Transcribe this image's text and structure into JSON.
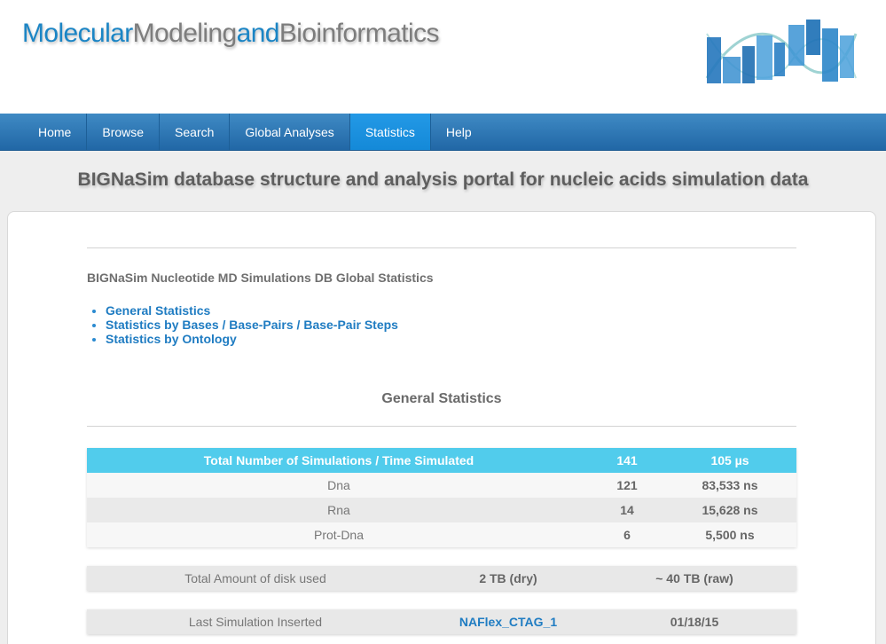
{
  "header": {
    "brand_part1": "Molecular",
    "brand_part2": "Modeling",
    "brand_part3": "and",
    "brand_part4": "Bioinformatics",
    "logo_icon": "bignasim-word-cloud-logo"
  },
  "nav": {
    "items": [
      {
        "label": "Home"
      },
      {
        "label": "Browse"
      },
      {
        "label": "Search"
      },
      {
        "label": "Global Analyses"
      },
      {
        "label": "Statistics"
      },
      {
        "label": "Help"
      }
    ],
    "active": "Statistics"
  },
  "page": {
    "headline": "BIGNaSim database structure and analysis portal for nucleic acids simulation data",
    "subtitle": "BIGNaSim Nucleotide MD Simulations DB Global Statistics",
    "links": [
      {
        "label": "General Statistics"
      },
      {
        "label": "Statistics by Bases / Base-Pairs / Base-Pair Steps"
      },
      {
        "label": "Statistics by Ontology"
      }
    ],
    "section_title": "General Statistics"
  },
  "stats_table": {
    "header": {
      "label": "Total Number of Simulations / Time Simulated",
      "count": "141",
      "time": "105 µs"
    },
    "rows": [
      {
        "label": "Dna",
        "count": "121",
        "time": "83,533 ns"
      },
      {
        "label": "Rna",
        "count": "14",
        "time": "15,628 ns"
      },
      {
        "label": "Prot-Dna",
        "count": "6",
        "time": "5,500 ns"
      }
    ]
  },
  "disk": {
    "label": "Total Amount of disk used",
    "dry": "2 TB (dry)",
    "raw": "~ 40 TB (raw)"
  },
  "last_sim": {
    "label": "Last Simulation Inserted",
    "name": "NAFlex_CTAG_1",
    "date": "01/18/15"
  },
  "colors": {
    "brand_blue": "#1b85c5",
    "nav_bg": "#2f79b7",
    "nav_active": "#1a90de",
    "table_head": "#51ccec",
    "link": "#1f7cc2"
  }
}
